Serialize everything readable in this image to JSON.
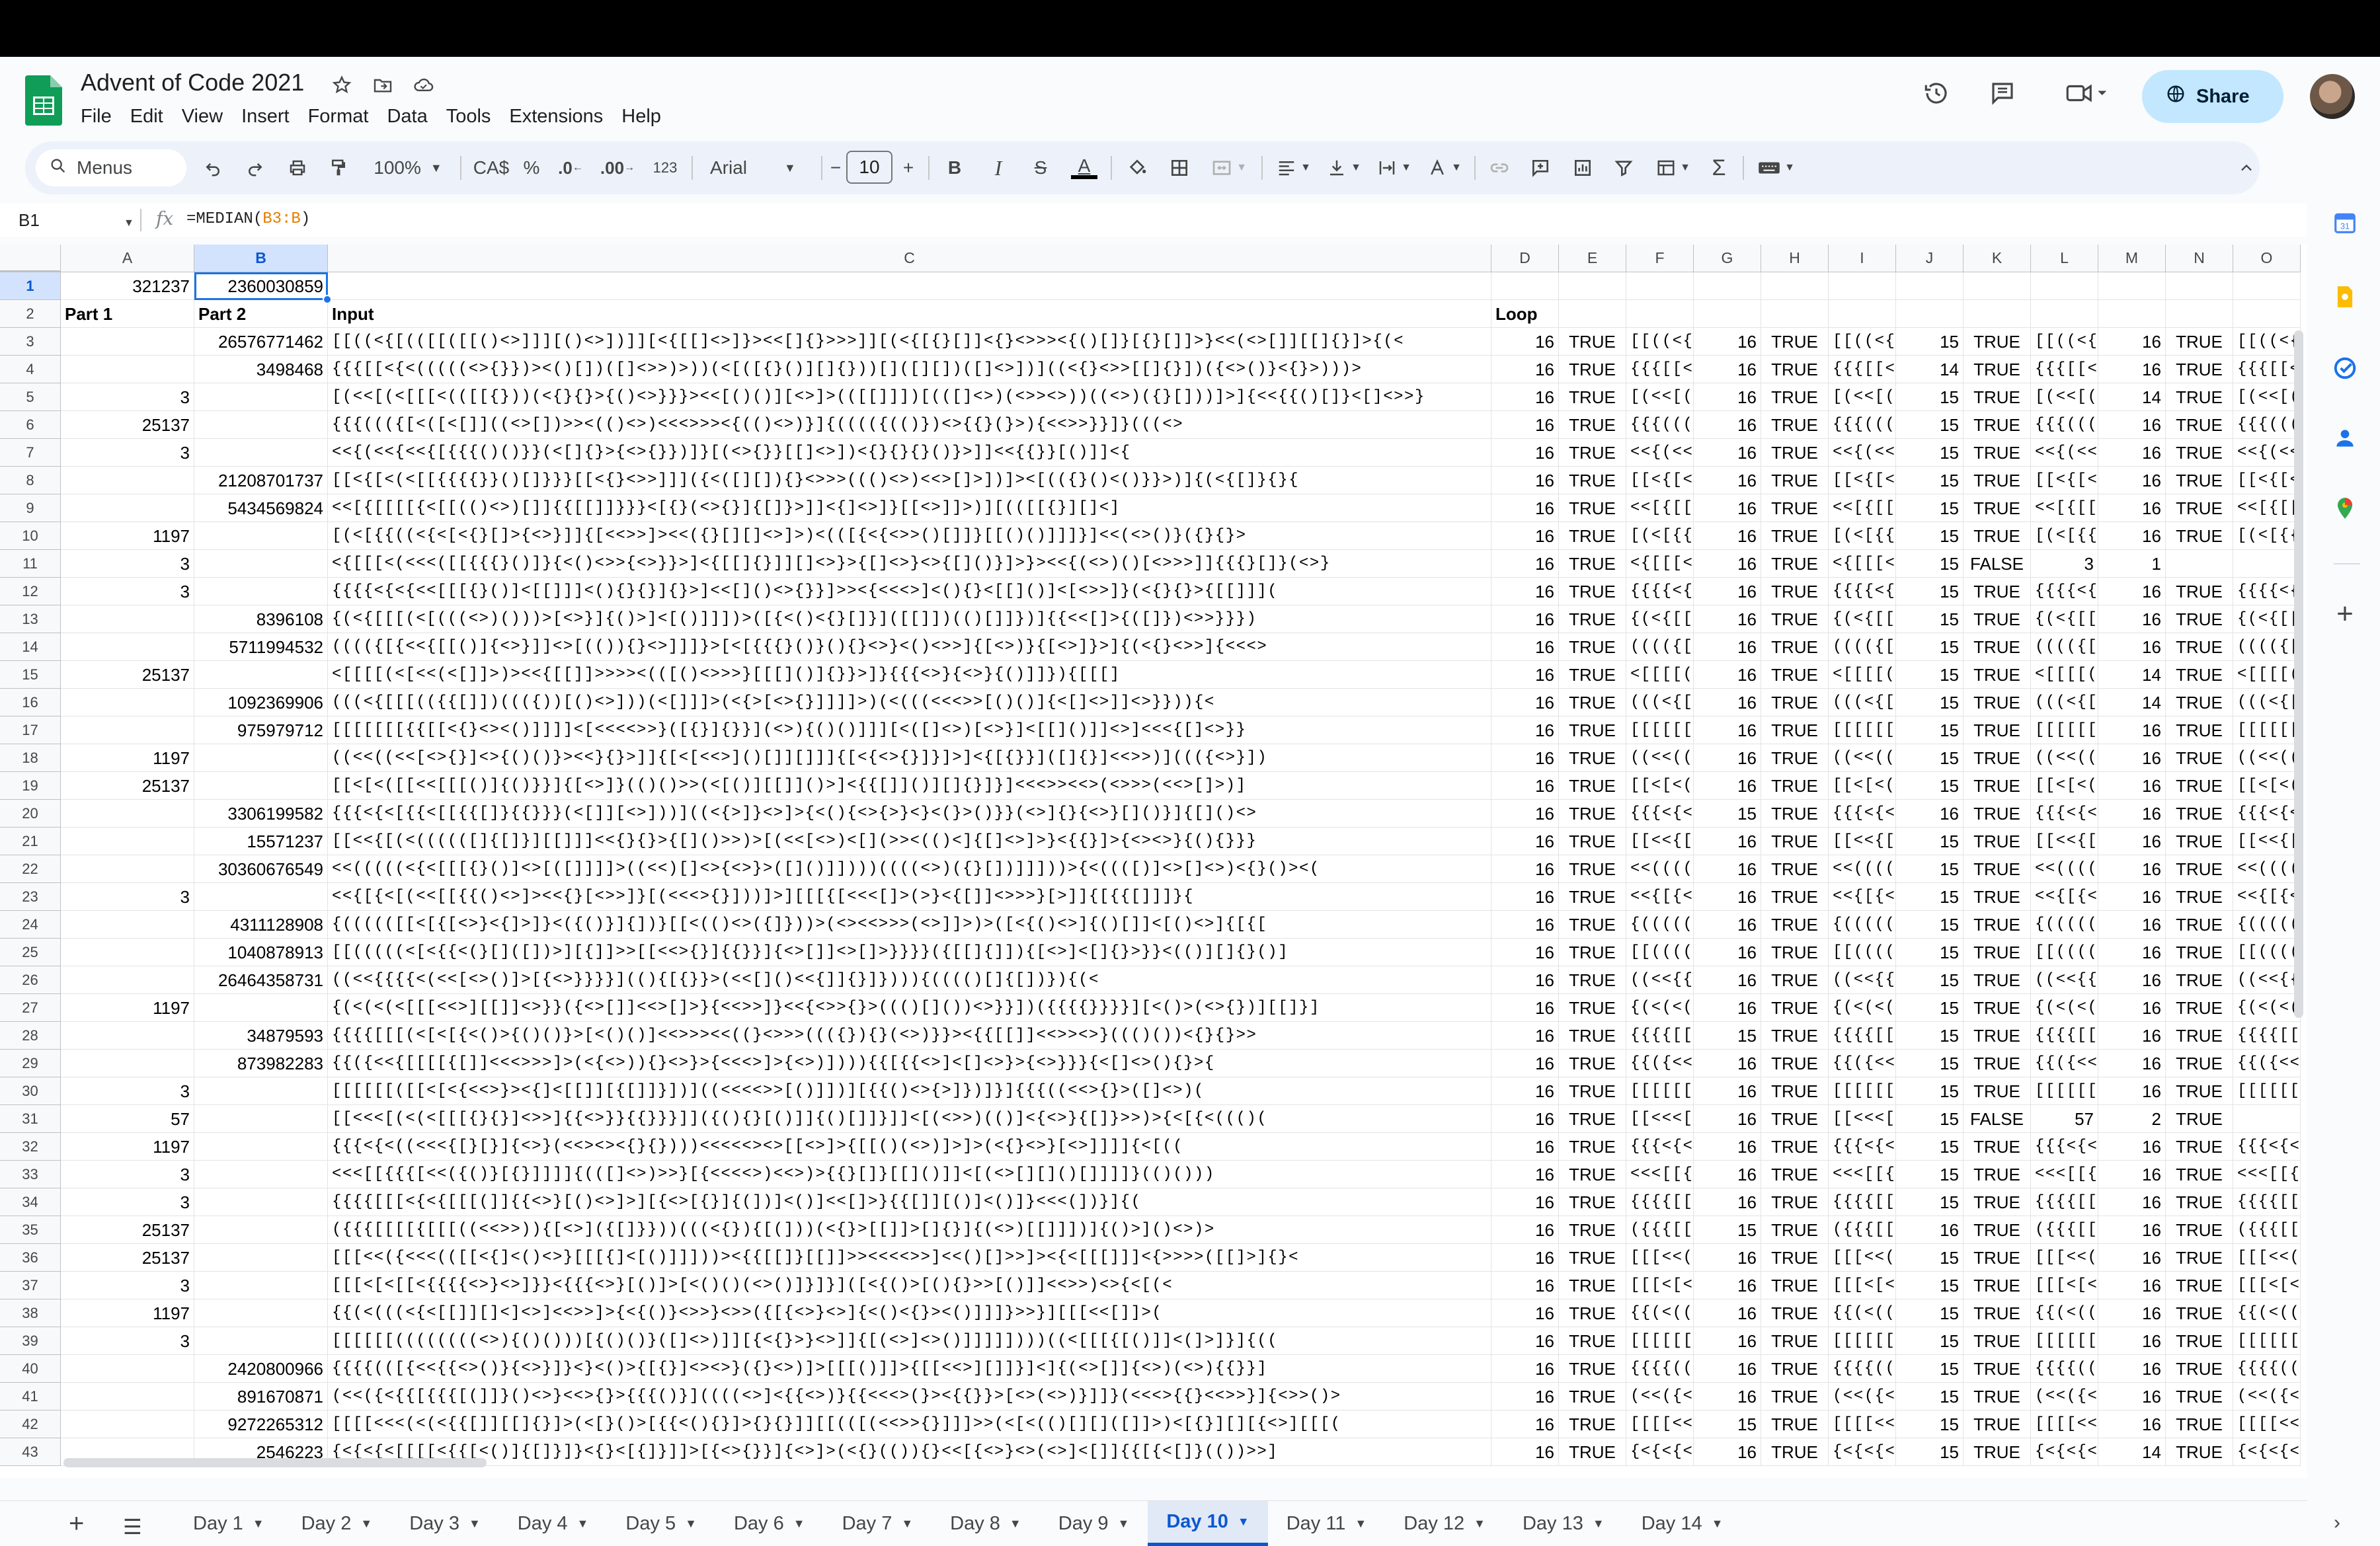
{
  "app": {
    "title": "Advent of Code 2021",
    "menu": [
      "File",
      "Edit",
      "View",
      "Insert",
      "Format",
      "Data",
      "Tools",
      "Extensions",
      "Help"
    ],
    "share_label": "Share"
  },
  "toolbar": {
    "search_label": "Menus",
    "zoom": "100%",
    "currency": "CA$",
    "percent": "%",
    "dec_decrease": ".0",
    "dec_increase": ".00",
    "num_format": "123",
    "font": "Arial",
    "font_size": "10",
    "bold": "B",
    "italic": "I",
    "strike": "S",
    "text_color": "A"
  },
  "formula_bar": {
    "cell_ref": "B1",
    "fx": "fx",
    "formula_prefix": "=MEDIAN(",
    "formula_ref": "B3:B",
    "formula_suffix": ")"
  },
  "columns": [
    "A",
    "B",
    "C",
    "D",
    "E",
    "F",
    "G",
    "H",
    "I",
    "J",
    "K",
    "L",
    "M",
    "N",
    "O"
  ],
  "rows": [
    {
      "n": "1",
      "A": "321237",
      "B": "2360030859",
      "C": ""
    },
    {
      "n": "2",
      "A": "Part 1",
      "B": "Part 2",
      "C": "Input",
      "D": "Loop"
    },
    {
      "n": "3",
      "A": "",
      "B": "26576771462",
      "C": "[[((<{[(([[([[()<>]]][()<>])]][<{[[]<>]}><<[]{}>>>]][(<{[{}[]]<{}<>>><{()[]}[{}[]]>}<<(<>[]][[]{}]>{(<",
      "D": "16",
      "E": "TRUE",
      "F": "[[((<{[(([[",
      "G": "16",
      "H": "TRUE",
      "I": "[[((<{[([[",
      "J": "15",
      "K": "TRUE",
      "L": "[[((<{[([[",
      "M": "16",
      "N": "TRUE",
      "O": "[[((<{[(["
    },
    {
      "n": "4",
      "A": "",
      "B": "3498468",
      "C": "{{{[[<{<(((((<>{}})><()[])([]<>>)>))(<[([{}()][]{}))[]([][])([]<>])]((<{}<>>[[]{}])({<>()}<{}>)))>",
      "D": "16",
      "E": "TRUE",
      "F": "{{{[[<{<((",
      "G": "16",
      "H": "TRUE",
      "I": "{{{[[<{<((",
      "J": "14",
      "K": "TRUE",
      "L": "{{{[[<{<((",
      "M": "16",
      "N": "TRUE",
      "O": "{{{[[<{<(("
    },
    {
      "n": "5",
      "A": "3",
      "B": "",
      "C": "[(<<[(<[[[<(([[{}))(<{}{}>{()<>}}}><<[()()][<>]>(([[]]])[(([]<>)(<>><>))((<>)({}[]))]>]{<<{{()[]}<[]<>>}",
      "D": "16",
      "E": "TRUE",
      "F": "[(<<[(<[[",
      "G": "16",
      "H": "TRUE",
      "I": "[(<<[(<[[",
      "J": "15",
      "K": "TRUE",
      "L": "[(<<[(<[[",
      "M": "14",
      "N": "TRUE",
      "O": "[(<<[(<[["
    },
    {
      "n": "6",
      "A": "25137",
      "B": "",
      "C": "{{{((({[<([<[]]((<>[])>><(()<>)<<<>>><{(()<>)}]{(((({(()})<>{{}(}>){<<>>}}]}(((<>",
      "D": "16",
      "E": "TRUE",
      "F": "{{{((({[<(",
      "G": "16",
      "H": "TRUE",
      "I": "{{{((({[<(",
      "J": "15",
      "K": "TRUE",
      "L": "{{{((({[<(",
      "M": "16",
      "N": "TRUE",
      "O": "{{{((({[<("
    },
    {
      "n": "7",
      "A": "3",
      "B": "",
      "C": "<<{(<<{<<{[{{{()()}}(<[]{}>{<>{}})]}[(<>{}}[[]<>])<{}{}{}()}>]]<<{{}}[()]]<{",
      "D": "16",
      "E": "TRUE",
      "F": "<<{(<<{<",
      "G": "16",
      "H": "TRUE",
      "I": "<<{(<<{<",
      "J": "15",
      "K": "TRUE",
      "L": "<<{(<<{<",
      "M": "16",
      "N": "TRUE",
      "O": "<<{(<<{<"
    },
    {
      "n": "8",
      "A": "",
      "B": "21208701737",
      "C": "[[<{[<(<[[{{{{}}()[]}}}[[<{}<>>]]]({<([][]){}<>>>((()<>)<<>[]>])]><[(({}()<()}}>)]{(<{[]}{}{",
      "D": "16",
      "E": "TRUE",
      "F": "[[<{[<(<[",
      "G": "16",
      "H": "TRUE",
      "I": "[[<{[<(<[",
      "J": "15",
      "K": "TRUE",
      "L": "[[<{[<(<[",
      "M": "16",
      "N": "TRUE",
      "O": "[[<{[<(<["
    },
    {
      "n": "9",
      "A": "",
      "B": "5434569824",
      "C": "<<[{[[[[{<[[(()<>)[]]{{[[]]}}}<[{}(<>{}]{[]}>]]<{]<>]}[[<>]]>)][(([[{}][]<]",
      "D": "16",
      "E": "TRUE",
      "F": "<<[{[[[[{",
      "G": "16",
      "H": "TRUE",
      "I": "<<[{[[[[{",
      "J": "15",
      "K": "TRUE",
      "L": "<<[{[[[[{",
      "M": "16",
      "N": "TRUE",
      "O": "<<[{[[[[{"
    },
    {
      "n": "10",
      "A": "1197",
      "B": "",
      "C": "[(<[{{((<{<[<{}[]>{<>}]]{[<<>>]><<({}[][]<>]>)<(([{<{<>>()[]]}[[()()]]]}]<<(<>()}({}{}>",
      "D": "16",
      "E": "TRUE",
      "F": "[(<[{{((<",
      "G": "16",
      "H": "TRUE",
      "I": "[(<[{{((<",
      "J": "15",
      "K": "TRUE",
      "L": "[(<[{{((<",
      "M": "16",
      "N": "TRUE",
      "O": "[(<[{{((<"
    },
    {
      "n": "11",
      "A": "3",
      "B": "",
      "C": "<{[[[<(<<<([[{{{}()]}{<()<>>{<>}}>]<{[[]{}]][]<>}>{[]<>}<>{[]()}]>}><<{(<>)()[<>>>]]{{{}[]}(<>}",
      "D": "16",
      "E": "TRUE",
      "F": "<{[[[<(<<",
      "G": "16",
      "H": "TRUE",
      "I": "<{[[[<(<<",
      "J": "15",
      "K": "FALSE",
      "L": "3",
      "M": "1",
      "N": "",
      "O": ""
    },
    {
      "n": "12",
      "A": "3",
      "B": "",
      "C": "{{{{<{<{<<[[[{}()]<[[]]]<(){}{}]{}>]<<[]()<>{}}]>><{<<<>]<(){}<[[]()]<[<>>]}(<{}{}>{[[]]](",
      "D": "16",
      "E": "TRUE",
      "F": "{{{{<{<{<",
      "G": "16",
      "H": "TRUE",
      "I": "{{{{<{<{<",
      "J": "15",
      "K": "TRUE",
      "L": "{{{{<{<{<",
      "M": "16",
      "N": "TRUE",
      "O": "{{{{<{<{<"
    },
    {
      "n": "13",
      "A": "",
      "B": "8396108",
      "C": "{(<{[[[(<[(((<>)()))>[<>}]{()>]<[()]]])>([{<()<{}[]}]([[]])(()[]]})]{{<<[]>{([]})<>>}}})",
      "D": "16",
      "E": "TRUE",
      "F": "{(<{[[[(<[",
      "G": "16",
      "H": "TRUE",
      "I": "{(<{[[[(<[",
      "J": "15",
      "K": "TRUE",
      "L": "{(<{[[[(<[",
      "M": "16",
      "N": "TRUE",
      "O": "{(<{[[[(<["
    },
    {
      "n": "14",
      "A": "",
      "B": "5711994532",
      "C": "(((({[{<<{[[()]{<>}]]<>[(()){}<>]]]}>[<[{{{}()}(){}<>}<()<>>]{[<>)}{[<>]}>]{(<{}<>>]{<<<>",
      "D": "16",
      "E": "TRUE",
      "F": "(((({[{<<{",
      "G": "16",
      "H": "TRUE",
      "I": "(((({[{<<{",
      "J": "15",
      "K": "TRUE",
      "L": "(((({[{<<{",
      "M": "16",
      "N": "TRUE",
      "O": "(((({[{<<{"
    },
    {
      "n": "15",
      "A": "25137",
      "B": "",
      "C": "<[[[[(<[<<(<[]]>)><<{[[]]>>>><(([()<>>>}[[[]()]{}}>]}{{{<>}{<>}{()]]}){[[[]",
      "D": "16",
      "E": "TRUE",
      "F": "<[[[[(<[<",
      "G": "16",
      "H": "TRUE",
      "I": "<[[[[(<[<",
      "J": "15",
      "K": "TRUE",
      "L": "<[[[[(<[<",
      "M": "14",
      "N": "TRUE",
      "O": "<[[[[(<[<"
    },
    {
      "n": "16",
      "A": "",
      "B": "1092369906",
      "C": "(((<{[[[(({{[]])((({))[()<>]))(<[]]]>(<{>[<>{}]]]]>)(<(((<<<>>[()()]{<[]<>]]<>}})){<",
      "D": "16",
      "E": "TRUE",
      "F": "(((<{[[[((",
      "G": "16",
      "H": "TRUE",
      "I": "(((<{[[[((",
      "J": "15",
      "K": "TRUE",
      "L": "(((<{[[[((",
      "M": "14",
      "N": "TRUE",
      "O": "(((<{[[[(("
    },
    {
      "n": "17",
      "A": "",
      "B": "975979712",
      "C": "[[[[[[[{{[[<{}<><()]]]]<[<<<<>>}([{}]{}}](<>){()()]]][<([]<>)[<>}]<[[]()]]<>]<<<{[]<>}}",
      "D": "16",
      "E": "TRUE",
      "F": "[[[[[[[{{[",
      "G": "16",
      "H": "TRUE",
      "I": "[[[[[[[{{[",
      "J": "15",
      "K": "TRUE",
      "L": "[[[[[[[{{[",
      "M": "16",
      "N": "TRUE",
      "O": "[[[[[[[{{["
    },
    {
      "n": "18",
      "A": "1197",
      "B": "",
      "C": "((<<((<<[<>{}]<>{()()}><<}{}>]]{[<[<<>]()[]][]]]{[<{<>{}]}]>]<{[{}}]([]{}]<<>>)]((({<>}])",
      "D": "16",
      "E": "TRUE",
      "F": "((<<((<<[",
      "G": "16",
      "H": "TRUE",
      "I": "((<<((<<[",
      "J": "15",
      "K": "TRUE",
      "L": "((<<((<<[",
      "M": "16",
      "N": "TRUE",
      "O": "((<<((<<["
    },
    {
      "n": "19",
      "A": "25137",
      "B": "",
      "C": "[[<[<([[<<[[[()]{()}}]{[<>]}(()()>>(<[()][[]]()>]<{{[]]()][]{}]}]<<<>><<>(<>>>(<<>[]>)]",
      "D": "16",
      "E": "TRUE",
      "F": "[[<[<([[<",
      "G": "16",
      "H": "TRUE",
      "I": "[[<[<([[<",
      "J": "15",
      "K": "TRUE",
      "L": "[[<[<([[<",
      "M": "16",
      "N": "TRUE",
      "O": "[[<[<([[<"
    },
    {
      "n": "20",
      "A": "",
      "B": "3306199582",
      "C": "{{{<{<[{{<[[{{[]}{{}}}(<[]][<>]))]((<{>]}<>]>{<(){<>{>}<}<(}>()}}(<>]{}{<>}[]()}]{[]()<>",
      "D": "16",
      "E": "TRUE",
      "F": "{{{<{<[{{<",
      "G": "15",
      "H": "TRUE",
      "I": "{{{<{<[{{<",
      "J": "16",
      "K": "TRUE",
      "L": "{{{<{<[{{<",
      "M": "16",
      "N": "TRUE",
      "O": "{{{<{<[{{<"
    },
    {
      "n": "21",
      "A": "",
      "B": "15571237",
      "C": "[[<<{[(<((((([]{[]}][[]]]<<{}{}>{[]()>>)>[(<<[<>)<[](>><(()<]{[]<>]>}<{{}]>{<><>}{(){}}}",
      "D": "16",
      "E": "TRUE",
      "F": "[[<<{[(<((",
      "G": "16",
      "H": "TRUE",
      "I": "[[<<{[(<((",
      "J": "15",
      "K": "TRUE",
      "L": "[[<<{[(<((",
      "M": "16",
      "N": "TRUE",
      "O": "[[<<{[(<(("
    },
    {
      "n": "22",
      "A": "",
      "B": "30360676549",
      "C": "<<(((((<{<[[[{}()]<>[([]]]]>((<<)[]<>{<>}>([]()]])))((((<>)({}[])]]]))>{<((([)]<>[]<>)<{}()><(",
      "D": "16",
      "E": "TRUE",
      "F": "<<(((((<{<",
      "G": "16",
      "H": "TRUE",
      "I": "<<(((((<{<",
      "J": "15",
      "K": "TRUE",
      "L": "<<(((((<{<",
      "M": "16",
      "N": "TRUE",
      "O": "<<(((((<{<"
    },
    {
      "n": "23",
      "A": "3",
      "B": "",
      "C": "<<{[{<[(<<[[{{()<>]><<{}[<>>]}[(<<<>{}]))]>][[[{[<<<[]>(>}<{[]]<>>>}[>]]{[{{[]]]}{",
      "D": "16",
      "E": "TRUE",
      "F": "<<{[{<[(<<",
      "G": "16",
      "H": "TRUE",
      "I": "<<{[{<[(<<",
      "J": "15",
      "K": "TRUE",
      "L": "<<{[{<[(<<",
      "M": "16",
      "N": "TRUE",
      "O": "<<{[{<[(<<"
    },
    {
      "n": "24",
      "A": "",
      "B": "4311128908",
      "C": "{((((([[<[{[<>}<{]>]}<({()}]{])}[[<(()<>({]}))>(<><<>>>(<>]]>)>([<{()<>]{()[]]<[()<>]{[{[",
      "D": "16",
      "E": "TRUE",
      "F": "{((((([[<[",
      "G": "16",
      "H": "TRUE",
      "I": "{((((([[<[",
      "J": "15",
      "K": "TRUE",
      "L": "{((((([[<[",
      "M": "16",
      "N": "TRUE",
      "O": "{((((([[<["
    },
    {
      "n": "25",
      "A": "",
      "B": "1040878913",
      "C": "[[(((((<[<{{<(}[]([])>][{]]>>[[<<>{}]{{}}]{<>[]]<>[]>}}}}({[[]{]]){[<>]<[]{}>}}<(()][]{}()]",
      "D": "16",
      "E": "TRUE",
      "F": "[[(((((<[<",
      "G": "16",
      "H": "TRUE",
      "I": "[[(((((<[<",
      "J": "15",
      "K": "TRUE",
      "L": "[[(((((<[<",
      "M": "16",
      "N": "TRUE",
      "O": "[[(((((<[<"
    },
    {
      "n": "26",
      "A": "",
      "B": "26464358731",
      "C": "((<<{{{{<(<<[<>()]>[{<>}}}}]((){[{}}>(<<[]()<<{]]{}]}))){(((()[]{[])}){(<",
      "D": "16",
      "E": "TRUE",
      "F": "((<<{{{{<(",
      "G": "16",
      "H": "TRUE",
      "I": "((<<{{{{<(",
      "J": "15",
      "K": "TRUE",
      "L": "((<<{{{{<(",
      "M": "16",
      "N": "TRUE",
      "O": "((<<{{{{<("
    },
    {
      "n": "27",
      "A": "1197",
      "B": "",
      "C": "{(<(<(<[[[<<>][[]]<>}}({<>[]]<<>[]>}{<<>>]}<<{<>>{}>((()[]())<>}}])({{{{}}}}][<()>(<>{})][[]}]",
      "D": "16",
      "E": "TRUE",
      "F": "{(<(<(<[[[",
      "G": "16",
      "H": "TRUE",
      "I": "{(<(<(<[[[",
      "J": "15",
      "K": "TRUE",
      "L": "{(<(<(<[[[",
      "M": "16",
      "N": "TRUE",
      "O": "{(<(<(<[[["
    },
    {
      "n": "28",
      "A": "",
      "B": "34879593",
      "C": "{{{{[[[(<[<[{<()>{()()}>[<()()]<<>>><<((}<>>>((({}){}(<>)}}><{{[[]]<<>><>}((()())<{}{}>>",
      "D": "16",
      "E": "TRUE",
      "F": "{{{{[[[(<[",
      "G": "15",
      "H": "TRUE",
      "I": "{{{{[[[(<[",
      "J": "15",
      "K": "TRUE",
      "L": "{{{{[[[(<[",
      "M": "16",
      "N": "TRUE",
      "O": "{{{{[[[(<["
    },
    {
      "n": "29",
      "A": "",
      "B": "873982283",
      "C": "{{({<<{[[[[{[]]<<<>>>]>(<{<>)){}<>}>{<<<>]>{<>)]))){{[{{<>]<[]<>}>{<>}}}{<[]<>(){}>{",
      "D": "16",
      "E": "TRUE",
      "F": "{{({<<{[[[",
      "G": "16",
      "H": "TRUE",
      "I": "{{({<<{[[[",
      "J": "15",
      "K": "TRUE",
      "L": "{{({<<{[[[",
      "M": "16",
      "N": "TRUE",
      "O": "{{({<<{[[["
    },
    {
      "n": "30",
      "A": "3",
      "B": "",
      "C": "[[[[[[([[<[<{<<>}><{]<[[]][{[]]}])]((<<<<>>[()]])][{{()<>{>]})]}]{{{((<<>{}>([]<>)(",
      "D": "16",
      "E": "TRUE",
      "F": "[[[[[[([[<[",
      "G": "16",
      "H": "TRUE",
      "I": "[[[[[[([[<[",
      "J": "15",
      "K": "TRUE",
      "L": "[[[[[[([[<[",
      "M": "16",
      "N": "TRUE",
      "O": "[[[[[[([[<["
    },
    {
      "n": "31",
      "A": "57",
      "B": "",
      "C": "[[<<<[(<(<[[[{}{}]<>>]{{<>}}{{}}}]]({(){}[()]]{()[]]}]]<[(<>>)(()]<{<>}{[]}>>)>{<[{<((()(",
      "D": "16",
      "E": "TRUE",
      "F": "[[<<<[(<(<",
      "G": "16",
      "H": "TRUE",
      "I": "[[<<<[(<(<",
      "J": "15",
      "K": "FALSE",
      "L": "57",
      "M": "2",
      "N": "TRUE",
      "O": ""
    },
    {
      "n": "32",
      "A": "1197",
      "B": "",
      "C": "{{{<{<((<<<{[}[}]{<>}(<<><><{}{})))<<<<<><>[[<>]>{[[()(<>)]>]>(<{}<>}[<>]]]]{<[((",
      "D": "16",
      "E": "TRUE",
      "F": "{{{<{<((<<",
      "G": "16",
      "H": "TRUE",
      "I": "{{{<{<((<<",
      "J": "15",
      "K": "TRUE",
      "L": "{{{<{<((<<",
      "M": "16",
      "N": "TRUE",
      "O": "{{{<{<((<<"
    },
    {
      "n": "33",
      "A": "3",
      "B": "",
      "C": "<<<[[{{{[<<({()}[{}]]]]{(([]<>)>>}[{<<<<>)<<>)>{{}[]}[[]()]]<[(<>[][]()[]]]]}(()()))",
      "D": "16",
      "E": "TRUE",
      "F": "<<<[[{{{[<",
      "G": "16",
      "H": "TRUE",
      "I": "<<<[[{{{[<",
      "J": "15",
      "K": "TRUE",
      "L": "<<<[[{{{[<",
      "M": "16",
      "N": "TRUE",
      "O": "<<<[[{{{[<"
    },
    {
      "n": "34",
      "A": "3",
      "B": "",
      "C": "{{{{[[[<{<{[[[(]]{{<>}[()<>]>][{<>[{}]{(])]<()]<<[]>}{{[]][()]<()]}<<<(])}]{(",
      "D": "16",
      "E": "TRUE",
      "F": "{{{{[[[<{<",
      "G": "16",
      "H": "TRUE",
      "I": "{{{{[[[<{<",
      "J": "15",
      "K": "TRUE",
      "L": "{{{{[[[<{<",
      "M": "16",
      "N": "TRUE",
      "O": "{{{{[[[<{<"
    },
    {
      "n": "35",
      "A": "25137",
      "B": "",
      "C": "({{{[[[[{[[[((<<>>)){[<>]({[]}}))(((<{}){[(]))(<{}>[[]]>[]{}]{(<>)[[]]])]{()>]()<>)>",
      "D": "16",
      "E": "TRUE",
      "F": "({{{[[[[{[",
      "G": "15",
      "H": "TRUE",
      "I": "({{{[[[[{[",
      "J": "16",
      "K": "TRUE",
      "L": "({{{[[[[{[",
      "M": "16",
      "N": "TRUE",
      "O": "({{{[[[[{["
    },
    {
      "n": "36",
      "A": "25137",
      "B": "",
      "C": "[[[<<({<<<(([[<{]<()<>}[[[{]<[()]]]))><{{[[]}[[]]>><<<<>>]<<()[]>>]><{<[[[]]]<{>>>>([[]>]{}<",
      "D": "16",
      "E": "TRUE",
      "F": "[[[<<({<<<",
      "G": "16",
      "H": "TRUE",
      "I": "[[[<<({<<<",
      "J": "15",
      "K": "TRUE",
      "L": "[[[<<({<<<",
      "M": "16",
      "N": "TRUE",
      "O": "[[[<<({<<<"
    },
    {
      "n": "37",
      "A": "3",
      "B": "",
      "C": "[[[<[<[[<{{{{<>}<>]}}<{{{<>}[()]>[<()()(<>()]}]}]([<{()>[(){}>>[()]]<<>>)<>{<[(<",
      "D": "16",
      "E": "TRUE",
      "F": "[[[<[<[[<{",
      "G": "16",
      "H": "TRUE",
      "I": "[[[<[<[[<{",
      "J": "15",
      "K": "TRUE",
      "L": "[[[<[<[[<{",
      "M": "16",
      "N": "TRUE",
      "O": "[[[<[<[[<{"
    },
    {
      "n": "38",
      "A": "1197",
      "B": "",
      "C": "{{(<(((<{<[[]][]<]<>]<<>>]>{<{()}<>>}<>>({[{<>}<>]{<()<{}><()]]]}>>}][[[<<[]]>(",
      "D": "16",
      "E": "TRUE",
      "F": "{{(<(((<{<",
      "G": "16",
      "H": "TRUE",
      "I": "{{(<(((<{<",
      "J": "15",
      "K": "TRUE",
      "L": "{{(<(((<{<",
      "M": "16",
      "N": "TRUE",
      "O": "{{(<(((<{<"
    },
    {
      "n": "39",
      "A": "3",
      "B": "",
      "C": "[[[[[[((((((((<>){()()))[{()()}([]<>)]][{<{}>}<>]]{[(<>]<>()]]]]])))((<[[[{[()]]<(]>]}]{((",
      "D": "16",
      "E": "TRUE",
      "F": "[[[[[[((((((",
      "G": "16",
      "H": "TRUE",
      "I": "[[[[[[((((((",
      "J": "15",
      "K": "TRUE",
      "L": "[[[[[[((((((",
      "M": "16",
      "N": "TRUE",
      "O": "[[[[[[(((((("
    },
    {
      "n": "40",
      "A": "",
      "B": "2420800966",
      "C": "{{{{(([{<<{{<>()}{<>}]}<}<()>{[{}]<><>}({}<>)]>[[[()]]>{[[<<>][]]}]<]{(<>[]]{<>)(<>){{}}]",
      "D": "16",
      "E": "TRUE",
      "F": "{{{{(([{<<",
      "G": "16",
      "H": "TRUE",
      "I": "{{{{(([{<<",
      "J": "15",
      "K": "TRUE",
      "L": "{{{{(([{<<",
      "M": "16",
      "N": "TRUE",
      "O": "{{{{(([{<<"
    },
    {
      "n": "41",
      "A": "",
      "B": "891670871",
      "C": "(<<({<{{[{{{[(]]}()<>}<<>{}>{{{()}]((((<>]<{{<>)}{{<<<>(}><{{}}>[<>(<>)}]]}(<<<>{{}<<>>}]{<>>()>",
      "D": "16",
      "E": "TRUE",
      "F": "(<<({<{{[{",
      "G": "16",
      "H": "TRUE",
      "I": "(<<({<{{[{",
      "J": "15",
      "K": "TRUE",
      "L": "(<<({<{{[{",
      "M": "16",
      "N": "TRUE",
      "O": "(<<({<{{[{"
    },
    {
      "n": "42",
      "A": "",
      "B": "9272265312",
      "C": "[[[[<<<(<(<{{[]][[]{}]>(<[}()>[{{<(){}]>{}{}]][[(([(<<>>{}]]]>>(<[<(()[][]([]]>)<[{}][][{<>][[[(",
      "D": "16",
      "E": "TRUE",
      "F": "[[[[<<<(<(",
      "G": "15",
      "H": "TRUE",
      "I": "[[[[<<<(<(",
      "J": "15",
      "K": "TRUE",
      "L": "[[[[<<<(<(",
      "M": "16",
      "N": "TRUE",
      "O": "[[[[<<<(<("
    },
    {
      "n": "43",
      "A": "",
      "B": "2546223",
      "C": "{<{<{<[[[[<{{[<()]{[]}]}<{}<[{]}]]>[{<>{}}]{<>]>(<{}(()){}<<[{<>}<>(<>]<[]]{{[{<[]}(())>>]",
      "D": "16",
      "E": "TRUE",
      "F": "{<{<{<[[[[",
      "G": "16",
      "H": "TRUE",
      "I": "{<{<{<[[[[",
      "J": "15",
      "K": "TRUE",
      "L": "{<{<{<[[[[",
      "M": "14",
      "N": "TRUE",
      "O": "{<{<{<[[[["
    }
  ],
  "sheets": [
    {
      "label": "Day 1"
    },
    {
      "label": "Day 2"
    },
    {
      "label": "Day 3"
    },
    {
      "label": "Day 4"
    },
    {
      "label": "Day 5"
    },
    {
      "label": "Day 6"
    },
    {
      "label": "Day 7"
    },
    {
      "label": "Day 8"
    },
    {
      "label": "Day 9"
    },
    {
      "label": "Day 10",
      "active": true
    },
    {
      "label": "Day 11"
    },
    {
      "label": "Day 12"
    },
    {
      "label": "Day 13"
    },
    {
      "label": "Day 14"
    }
  ],
  "colors": {
    "accent": "#0b57d0",
    "selection": "#1a73e8",
    "share_bg": "#c2e7ff",
    "sheets_green": "#0f9d58"
  }
}
